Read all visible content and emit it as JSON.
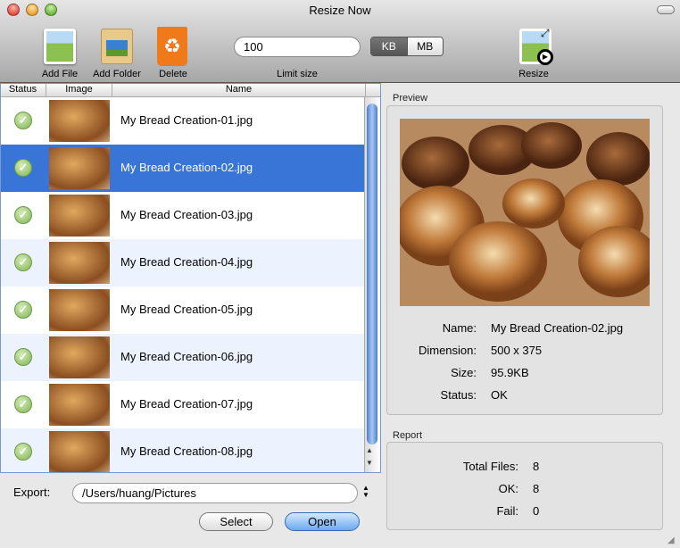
{
  "window": {
    "title": "Resize Now"
  },
  "toolbar": {
    "add_file": "Add File",
    "add_folder": "Add Folder",
    "delete": "Delete",
    "limit_value": "100",
    "limit_label": "Limit size",
    "unit_kb": "KB",
    "unit_mb": "MB",
    "unit_selected": "KB",
    "resize": "Resize"
  },
  "table": {
    "columns": [
      "Status",
      "Image",
      "Name"
    ],
    "rows": [
      {
        "name": "My Bread Creation-01.jpg",
        "status": "ok"
      },
      {
        "name": "My Bread Creation-02.jpg",
        "status": "ok",
        "selected": true
      },
      {
        "name": "My Bread Creation-03.jpg",
        "status": "ok"
      },
      {
        "name": "My Bread Creation-04.jpg",
        "status": "ok"
      },
      {
        "name": "My Bread Creation-05.jpg",
        "status": "ok"
      },
      {
        "name": "My Bread Creation-06.jpg",
        "status": "ok"
      },
      {
        "name": "My Bread Creation-07.jpg",
        "status": "ok"
      },
      {
        "name": "My Bread Creation-08.jpg",
        "status": "ok"
      }
    ]
  },
  "export": {
    "label": "Export:",
    "path": "/Users/huang/Pictures",
    "select": "Select",
    "open": "Open"
  },
  "preview": {
    "title": "Preview",
    "name_label": "Name:",
    "name": "My Bread Creation-02.jpg",
    "dimension_label": "Dimension:",
    "dimension": "500 x 375",
    "size_label": "Size:",
    "size": "95.9KB",
    "status_label": "Status:",
    "status": "OK"
  },
  "report": {
    "title": "Report",
    "total_label": "Total Files:",
    "total": "8",
    "ok_label": "OK:",
    "ok": "8",
    "fail_label": "Fail:",
    "fail": "0"
  },
  "colors": {
    "selection": "#3875d7",
    "alt_row": "#edf3fe",
    "ok_green": "#7fb552"
  }
}
